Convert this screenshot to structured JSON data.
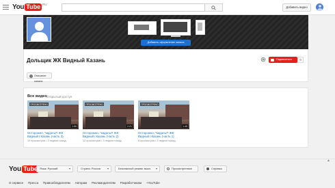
{
  "header": {
    "logo_text_you": "You",
    "logo_text_tube": "Tube",
    "logo_region": "RU",
    "search_placeholder": "",
    "upload_label": "Добавить видео"
  },
  "channel": {
    "title": "Дольщик ЖК Видный Казань",
    "art_button": "Добавить оформление канала",
    "subscribe_label": "Подписаться",
    "subscriber_count": "0",
    "about_button": "Описание канала"
  },
  "videos_section": {
    "title": "Все видео",
    "access": "Открытый доступ",
    "videos": [
      {
        "title_line1": "Осторожно, \"кидалы\"! ЖК",
        "title_line2": "Видный г.Казань (часть 3)",
        "views": "10 просмотров",
        "age": "3 недели назад",
        "duration": "1:55",
        "badge": "ПРОСМОТРЕНО"
      },
      {
        "title_line1": "Осторожно, \"кидалы\"! ЖК",
        "title_line2": "Видный г.Казань (часть 2)",
        "views": "12 просмотров",
        "age": "3 недели назад",
        "duration": "2:21",
        "badge": "ПРОСМОТРЕНО"
      },
      {
        "title_line1": "Осторожно, \"кидалы\"! ЖК",
        "title_line2": "Видный г.Казань (часть 1)",
        "views": "8 просмотров",
        "age": "3 недели назад",
        "duration": "1:45",
        "badge": "ПРОСМОТРЕНО"
      }
    ]
  },
  "footer": {
    "language": "Язык: Русский",
    "country": "Страна: Россия",
    "safety": "Безопасный режим: выкл.",
    "history": "Просмотренные",
    "help": "Справка",
    "links": [
      "О сервисе",
      "Пресса",
      "Правообладателям",
      "Авторам",
      "Рекламодателям",
      "Разработчикам",
      "+YouTube"
    ]
  },
  "colors": {
    "accent_red": "#e62117",
    "link_blue": "#167ac6",
    "primary_blue": "#1f6fd1"
  }
}
